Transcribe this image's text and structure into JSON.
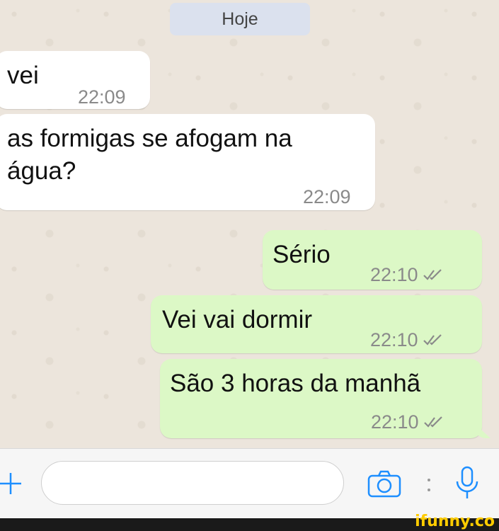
{
  "date_label": "Hoje",
  "messages": [
    {
      "direction": "incoming",
      "text": "vei",
      "time": "22:09"
    },
    {
      "direction": "incoming",
      "text": "as formigas se afogam na água?",
      "time": "22:09"
    },
    {
      "direction": "outgoing",
      "text": "Sério",
      "time": "22:10",
      "status": "read"
    },
    {
      "direction": "outgoing",
      "text": "Vei vai dormir",
      "time": "22:10",
      "status": "read"
    },
    {
      "direction": "outgoing",
      "text": "São 3 horas da manhã",
      "time": "22:10",
      "status": "read"
    }
  ],
  "input": {
    "value": "",
    "placeholder": ""
  },
  "icons": {
    "attach": "plus-icon",
    "camera": "camera-icon",
    "more": "dots-icon",
    "mic": "microphone-icon",
    "read_receipt": "double-check-icon"
  },
  "colors": {
    "accent": "#1e8fff",
    "outgoing_bubble": "#dcf8c6",
    "incoming_bubble": "#ffffff",
    "brand": "#ffcc00"
  },
  "brand": {
    "watermark": "ifunny.co"
  }
}
